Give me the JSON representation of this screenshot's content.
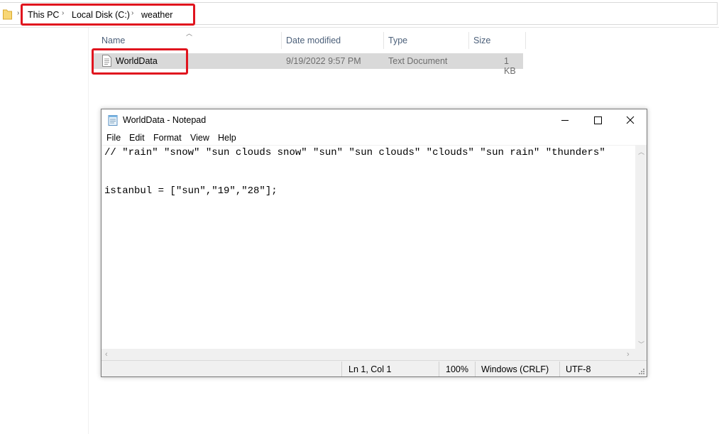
{
  "explorer": {
    "breadcrumb": [
      "This PC",
      "Local Disk (C:)",
      "weather"
    ],
    "columns": [
      "Name",
      "Date modified",
      "Type",
      "Size"
    ],
    "files": [
      {
        "name": "WorldData",
        "date": "9/19/2022 9:57 PM",
        "type": "Text Document",
        "size": "1 KB"
      }
    ]
  },
  "notepad": {
    "title": "WorldData - Notepad",
    "menu": [
      "File",
      "Edit",
      "Format",
      "View",
      "Help"
    ],
    "lines": [
      "// \"rain\" \"snow\" \"sun clouds snow\" \"sun\" \"sun clouds\" \"clouds\" \"sun rain\" \"thunders\"",
      "",
      "",
      "istanbul = [\"sun\",\"19\",\"28\"];"
    ],
    "status": {
      "position": "Ln 1, Col 1",
      "zoom": "100%",
      "line_ending": "Windows (CRLF)",
      "encoding": "UTF-8"
    }
  },
  "colors": {
    "highlight": "#e0141e",
    "selected_row": "#d9d9d9",
    "header_text": "#4c607a"
  }
}
